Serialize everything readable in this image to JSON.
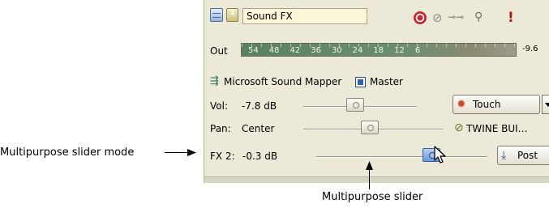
{
  "track": {
    "number": "1",
    "name": "Sound FX"
  },
  "meter": {
    "label": "Out",
    "scale": [
      "54",
      "48",
      "42",
      "36",
      "30",
      "24",
      "18",
      "12",
      "6"
    ],
    "peak": "-9.6"
  },
  "device": {
    "name": "Microsoft Sound Mapper",
    "master_label": "Master",
    "master_checked": true
  },
  "volume": {
    "label": "Vol:",
    "value": "-7.8 dB",
    "level_fraction": 0.4,
    "automation_label": "Touch"
  },
  "pan": {
    "label": "Pan:",
    "value": "Center",
    "level_fraction": 0.5,
    "plugin_label": "TWINE BUI…"
  },
  "multipurpose": {
    "label": "FX 2:",
    "value": "-0.3 dB",
    "level_fraction": 0.69,
    "post_label": "Post"
  },
  "callouts": {
    "mode": "Multipurpose slider mode",
    "slider": "Multipurpose slider"
  },
  "colors": {
    "panel_bg": "#ece9d8",
    "name_box_bg": "#fbf6d7",
    "active_thumb": "#6c96d2"
  },
  "icons": [
    "track-stack-icon",
    "record-arm-icon",
    "mute-icon",
    "solo-icon",
    "fx-chain-icon",
    "warning-icon",
    "device-icon",
    "touch-automation-icon",
    "plugin-icon",
    "post-icon",
    "mouse-pointer-icon"
  ]
}
